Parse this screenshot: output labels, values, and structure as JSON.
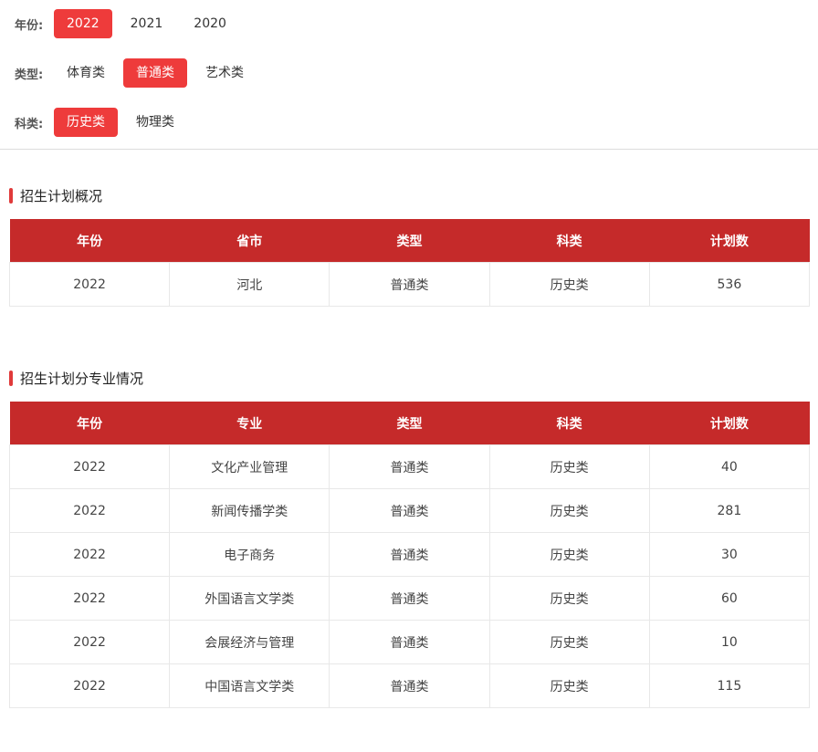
{
  "filters": {
    "year": {
      "label": "年份:",
      "options": [
        "2022",
        "2021",
        "2020"
      ],
      "active": 0
    },
    "type": {
      "label": "类型:",
      "options": [
        "体育类",
        "普通类",
        "艺术类"
      ],
      "active": 1
    },
    "subject": {
      "label": "科类:",
      "options": [
        "历史类",
        "物理类"
      ],
      "active": 0
    }
  },
  "overview": {
    "title": "招生计划概况",
    "headers": [
      "年份",
      "省市",
      "类型",
      "科类",
      "计划数"
    ],
    "rows": [
      [
        "2022",
        "河北",
        "普通类",
        "历史类",
        "536"
      ]
    ]
  },
  "majors": {
    "title": "招生计划分专业情况",
    "headers": [
      "年份",
      "专业",
      "类型",
      "科类",
      "计划数"
    ],
    "rows": [
      [
        "2022",
        "文化产业管理",
        "普通类",
        "历史类",
        "40"
      ],
      [
        "2022",
        "新闻传播学类",
        "普通类",
        "历史类",
        "281"
      ],
      [
        "2022",
        "电子商务",
        "普通类",
        "历史类",
        "30"
      ],
      [
        "2022",
        "外国语言文学类",
        "普通类",
        "历史类",
        "60"
      ],
      [
        "2022",
        "会展经济与管理",
        "普通类",
        "历史类",
        "10"
      ],
      [
        "2022",
        "中国语言文学类",
        "普通类",
        "历史类",
        "115"
      ]
    ]
  },
  "colors": {
    "accent": "#ee3b3b",
    "table_header": "#c52a2a",
    "section_bar": "#e03a3a"
  }
}
